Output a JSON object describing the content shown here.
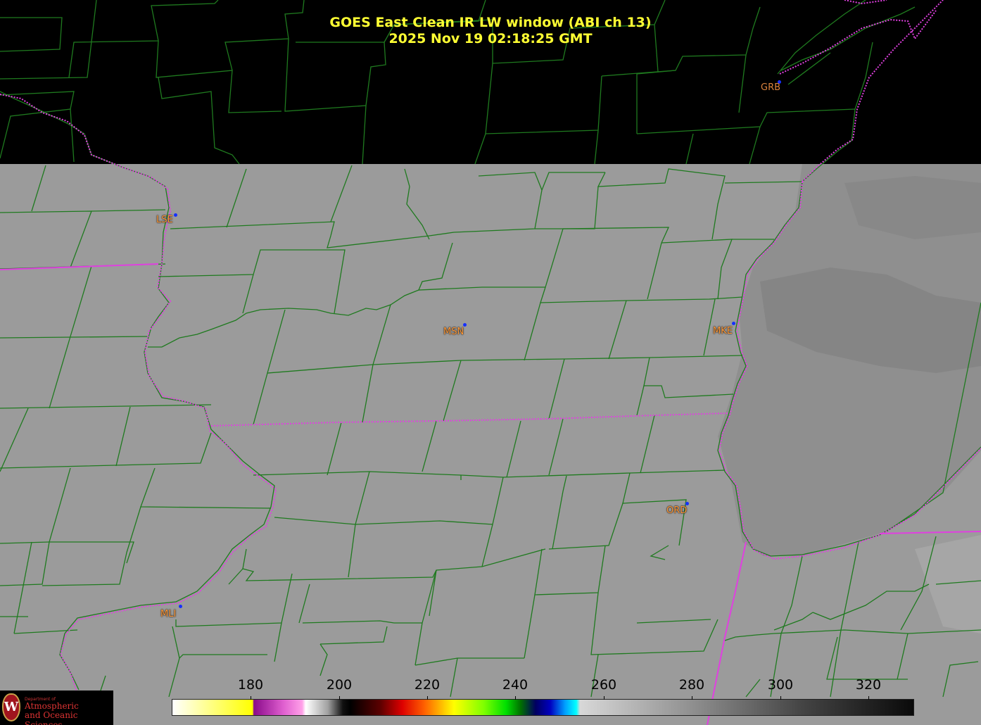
{
  "title": {
    "line1": "GOES East Clean IR LW window (ABI ch 13)",
    "line2": "2025 Nov 19  02:18:25 GMT"
  },
  "stations": [
    {
      "id": "GRB",
      "name": "grb"
    },
    {
      "id": "LSE",
      "name": "lse"
    },
    {
      "id": "MSN",
      "name": "msn"
    },
    {
      "id": "MKE",
      "name": "mke"
    },
    {
      "id": "ORD",
      "name": "ord"
    },
    {
      "id": "MLI",
      "name": "mli"
    }
  ],
  "colorbar": {
    "min": 163,
    "max": 330,
    "unit_hint": "brightness temperature (K)",
    "ticks": [
      "180",
      "200",
      "220",
      "240",
      "260",
      "280",
      "300",
      "320"
    ]
  },
  "logo": {
    "dept": "Department of",
    "line1": "Atmospheric",
    "line2": "and Oceanic Sciences",
    "seal_letter": "W"
  },
  "colors": {
    "title": "#ffff33",
    "county_lines": "#1f7a1f",
    "state_lines": "#e040e0",
    "land_gray": "#9b9b9b",
    "no_data": "#000000",
    "station_label": "#d9823d",
    "station_dot": "#1530ff"
  }
}
